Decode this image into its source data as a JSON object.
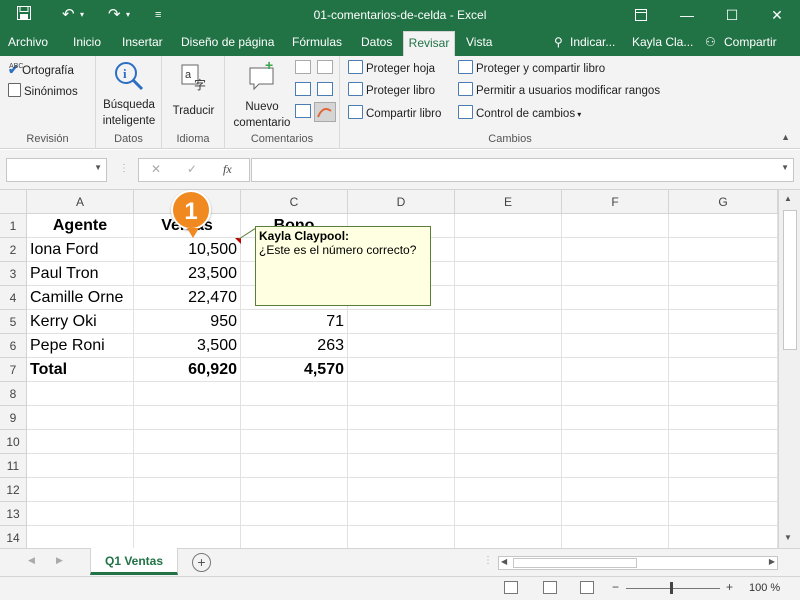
{
  "window": {
    "title": "01-comentarios-de-celda  -  Excel"
  },
  "tabs": [
    "Archivo",
    "Inicio",
    "Insertar",
    "Diseño de página",
    "Fórmulas",
    "Datos",
    "Revisar",
    "Vista"
  ],
  "tellme": "Indicar...",
  "user": "Kayla Cla...",
  "share": "Compartir",
  "ribbon": {
    "revision": {
      "ortografia": "Ortografía",
      "sinonimos": "Sinónimos",
      "label": "Revisión"
    },
    "datos": {
      "busqueda": "Búsqueda inteligente",
      "label": "Datos"
    },
    "idioma": {
      "traducir": "Traducir",
      "label": "Idioma"
    },
    "comentarios": {
      "nuevo": "Nuevo comentario",
      "label": "Comentarios"
    },
    "cambios": {
      "proteger_hoja": "Proteger hoja",
      "proteger_libro": "Proteger libro",
      "compartir_libro": "Compartir libro",
      "proteger_compartir": "Proteger y compartir libro",
      "permitir": "Permitir a usuarios modificar rangos",
      "control": "Control de cambios",
      "label": "Cambios"
    }
  },
  "formula": {
    "fx": "fx",
    "cancel": "✕",
    "enter": "✓"
  },
  "columns": [
    "A",
    "B",
    "C",
    "D",
    "E",
    "F",
    "G"
  ],
  "rows": [
    "1",
    "2",
    "3",
    "4",
    "5",
    "6",
    "7",
    "8",
    "9",
    "10",
    "11",
    "12",
    "13",
    "14"
  ],
  "table": {
    "h_agente": "Agente",
    "h_ventas": "Ventas",
    "h_bono": "Bono",
    "r2a": "Iona Ford",
    "r2b": "10,500",
    "r3a": "Paul Tron",
    "r3b": "23,500",
    "r4a": "Camille Orne",
    "r4b": "22,470",
    "r5a": "Kerry Oki",
    "r5b": "950",
    "r5c": "71",
    "r6a": "Pepe Roni",
    "r6b": "3,500",
    "r6c": "263",
    "r7a": "Total",
    "r7b": "60,920",
    "r7c": "4,570"
  },
  "comment": {
    "author": "Kayla Claypool:",
    "text": "¿Este es el número correcto?"
  },
  "marker": "1",
  "sheet": {
    "name": "Q1 Ventas"
  },
  "status": {
    "zoom": "100 %"
  },
  "colors": {
    "excel_green": "#217346",
    "comment_bg": "#ffffe1",
    "marker": "#f0891f"
  }
}
